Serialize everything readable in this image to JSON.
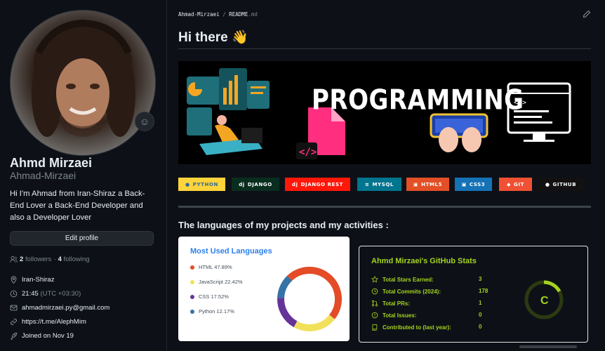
{
  "profile": {
    "name": "Ahmd Mirzaei",
    "login": "Ahmad-Mirzaei",
    "bio": "Hi I'm Ahmad from Iran-Shiraz a Back-End Lover a Back-End Developer and also a Developer Lover",
    "edit_label": "Edit profile",
    "followers_count": "2",
    "followers_label": "followers",
    "separator": "·",
    "following_count": "4",
    "following_label": "following",
    "location": "Iran-Shiraz",
    "time": "21:45",
    "timezone": "(UTC +03:30)",
    "email": "ahmadmirzaei.py@gmail.com",
    "link": "https://t.me/AlephMim",
    "joined": "Joined on Nov 19"
  },
  "readme": {
    "breadcrumb_user": "Ahmad-Mirzaei",
    "breadcrumb_sep": "/",
    "breadcrumb_file": "README",
    "breadcrumb_ext": ".md",
    "title": "Hi there 👋",
    "banner_text": "PROGRAMMING",
    "section_title": "The languages of my projects and my activities :"
  },
  "badges": [
    {
      "label": "PYTHON",
      "bg": "#ffd43b",
      "fg": "#306998",
      "icon": "python-icon"
    },
    {
      "label": "DJANGO",
      "bg": "#092e20",
      "fg": "#ffffff",
      "icon": "django-icon"
    },
    {
      "label": "DJANGO REST",
      "bg": "#ff1709",
      "fg": "#ffffff",
      "icon": "django-rest-icon"
    },
    {
      "label": "MYSQL",
      "bg": "#00758f",
      "fg": "#ffffff",
      "icon": "mysql-icon"
    },
    {
      "label": "HTML5",
      "bg": "#e34f26",
      "fg": "#ffffff",
      "icon": "html5-icon"
    },
    {
      "label": "CSS3",
      "bg": "#1572b6",
      "fg": "#ffffff",
      "icon": "css3-icon"
    },
    {
      "label": "GIT",
      "bg": "#f05033",
      "fg": "#ffffff",
      "icon": "git-icon"
    },
    {
      "label": "GITHUB",
      "bg": "#121011",
      "fg": "#ffffff",
      "icon": "github-icon"
    }
  ],
  "languages": {
    "title": "Most Used Languages",
    "items": [
      {
        "name": "HTML",
        "percent": "47.89%",
        "value": 47.89,
        "color": "#e34c26"
      },
      {
        "name": "JavaScript",
        "percent": "22.42%",
        "value": 22.42,
        "color": "#f1e05a"
      },
      {
        "name": "CSS",
        "percent": "17.52%",
        "value": 17.52,
        "color": "#663399"
      },
      {
        "name": "Python",
        "percent": "12.17%",
        "value": 12.17,
        "color": "#3572a5"
      }
    ]
  },
  "stats": {
    "title": "Ahmd Mirzaei's GitHub Stats",
    "rank": "C",
    "rows": [
      {
        "label": "Total Stars Earned:",
        "value": "3",
        "icon": "star-icon"
      },
      {
        "label": "Total Commits (2024):",
        "value": "178",
        "icon": "history-icon"
      },
      {
        "label": "Total PRs:",
        "value": "1",
        "icon": "pull-request-icon"
      },
      {
        "label": "Total Issues:",
        "value": "0",
        "icon": "issue-icon"
      },
      {
        "label": "Contributed to (last year):",
        "value": "0",
        "icon": "repo-icon"
      }
    ]
  },
  "colors": {
    "background": "#0d1117",
    "accent_green": "#a5d21f",
    "link_blue": "#2f80ed"
  }
}
